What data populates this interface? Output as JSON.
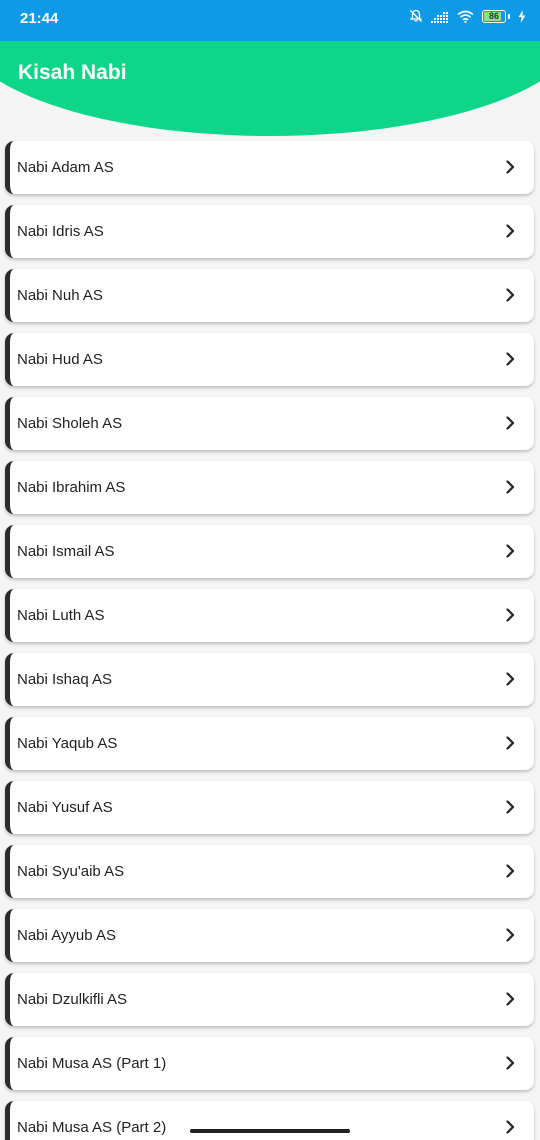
{
  "status_bar": {
    "time": "21:44",
    "battery_level": "86",
    "battery_fraction": 0.86,
    "icons": [
      "bell-muted-icon",
      "signal-icon",
      "wifi-icon",
      "battery-icon",
      "charging-icon"
    ]
  },
  "header": {
    "title": "Kisah Nabi",
    "color": "#0dd68a"
  },
  "colors": {
    "status_bar": "#0f9ae8",
    "accent_bar": "#2b2b2b",
    "background": "#f5f5f5"
  },
  "list": {
    "chevron_icon": "chevron-right-icon",
    "items": [
      {
        "label": "Nabi Adam AS"
      },
      {
        "label": "Nabi Idris AS"
      },
      {
        "label": "Nabi Nuh AS"
      },
      {
        "label": "Nabi Hud AS"
      },
      {
        "label": "Nabi Sholeh AS"
      },
      {
        "label": "Nabi Ibrahim AS"
      },
      {
        "label": "Nabi Ismail AS"
      },
      {
        "label": "Nabi Luth AS"
      },
      {
        "label": "Nabi Ishaq AS"
      },
      {
        "label": "Nabi Yaqub AS"
      },
      {
        "label": "Nabi Yusuf AS"
      },
      {
        "label": "Nabi Syu'aib AS"
      },
      {
        "label": "Nabi Ayyub AS"
      },
      {
        "label": "Nabi Dzulkifli AS"
      },
      {
        "label": "Nabi Musa AS (Part 1)"
      },
      {
        "label": "Nabi Musa AS (Part 2)"
      }
    ]
  }
}
